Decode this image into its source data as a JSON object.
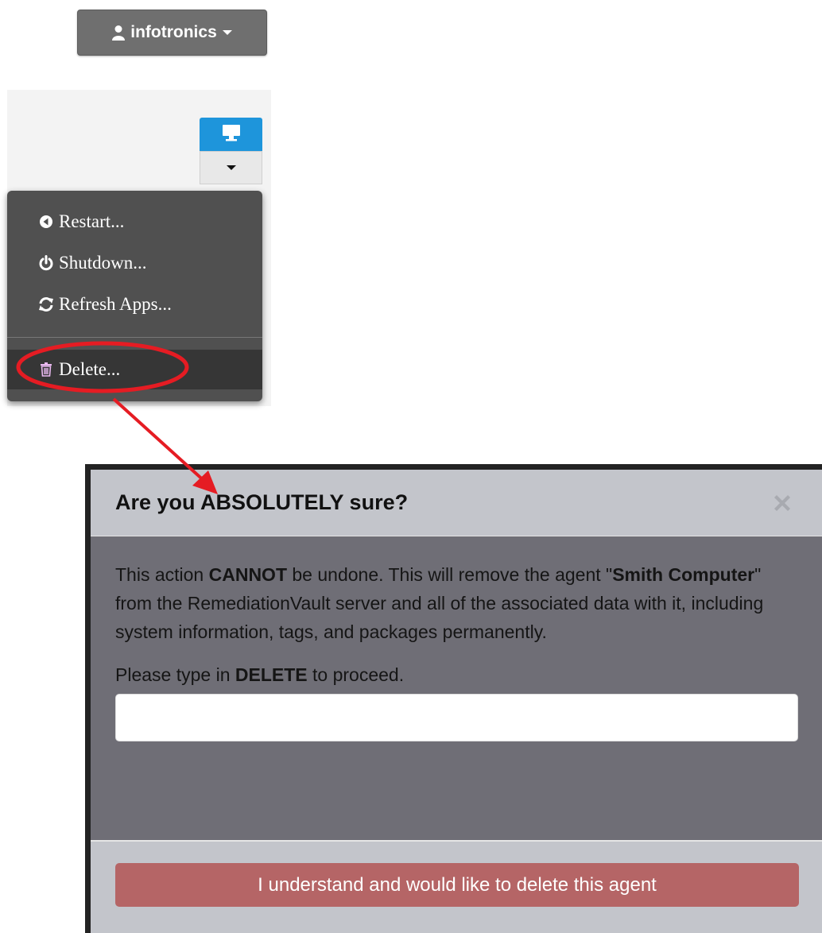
{
  "user_menu": {
    "username": "infotronics",
    "user_icon": "user-icon",
    "caret_icon": "caret-down-icon"
  },
  "agent_controls": {
    "monitor_icon": "desktop-icon",
    "caret_icon": "caret-down-icon"
  },
  "dropdown": {
    "items": [
      {
        "label": "Restart...",
        "icon": "restart-icon"
      },
      {
        "label": "Shutdown...",
        "icon": "power-icon"
      },
      {
        "label": "Refresh Apps...",
        "icon": "refresh-icon"
      }
    ],
    "delete_item": {
      "label": "Delete...",
      "icon": "trash-icon"
    }
  },
  "annotation": {
    "color": "#e51c23"
  },
  "modal": {
    "title": "Are you ABSOLUTELY sure?",
    "close_icon": "close-icon",
    "body": {
      "p1_a": "This action ",
      "p1_b": "CANNOT",
      "p1_c": " be undone. This will remove the agent \"",
      "p1_d": "Smith Computer",
      "p1_e": "\" from the RemediationVault server and all of the associated data with it, including system information, tags, and packages permanently.",
      "prompt_a": "Please type in ",
      "prompt_b": "DELETE",
      "prompt_c": " to proceed."
    },
    "input_value": "",
    "confirm_button": "I understand and would like to delete this agent",
    "colors": {
      "header": "#c3c5cb",
      "body": "#6f6e76",
      "button": "#b56566"
    }
  }
}
